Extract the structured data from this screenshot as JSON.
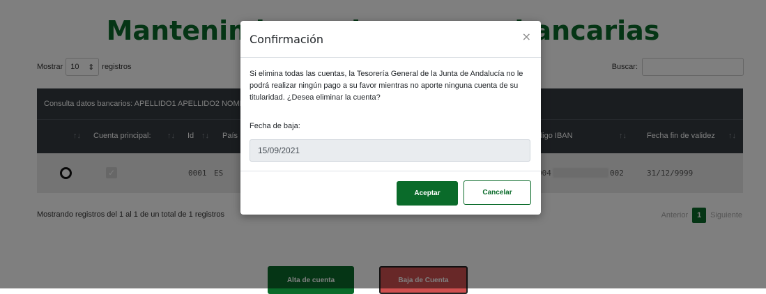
{
  "page": {
    "title": "Mantenimiento de cuentas bancarias"
  },
  "table_controls": {
    "show_label": "Mostrar",
    "page_length": "10",
    "records_label": "registros",
    "search_label": "Buscar:",
    "search_value": ""
  },
  "table": {
    "caption": "Consulta datos bancarios: APELLIDO1 APELLIDO2 NOMBRE",
    "columns": [
      "",
      "Cuenta principal:",
      "Id",
      "País",
      "Código IBAN",
      "Fecha fin de validez"
    ],
    "rows": [
      {
        "id": "0001",
        "country": "ES",
        "iban_start": "004",
        "iban_end": "002",
        "end_date": "31/12/9999"
      }
    ]
  },
  "info": "Mostrando registros del 1 al 1 de un total de 1 registros",
  "pagination": {
    "previous": "Anterior",
    "current": "1",
    "next": "Siguiente"
  },
  "actions": {
    "add_account": "Alta de cuenta",
    "remove_account": "Baja de Cuenta"
  },
  "modal": {
    "title": "Confirmación",
    "close_glyph": "×",
    "message": "Si elimina todas las cuentas, la Tesorería General de la Junta de Andalucía no le podrá realizar ningún pago a su favor mientras no aporte ninguna cuenta de su titularidad. ¿Desea eliminar la cuenta?",
    "date_label": "Fecha de baja:",
    "date_value": "15/09/2021",
    "accept_label": "Aceptar",
    "cancel_label": "Cancelar"
  },
  "colors": {
    "brand_green": "#0a6b2a",
    "danger_red": "#d05050",
    "header_dark": "#343a40"
  }
}
